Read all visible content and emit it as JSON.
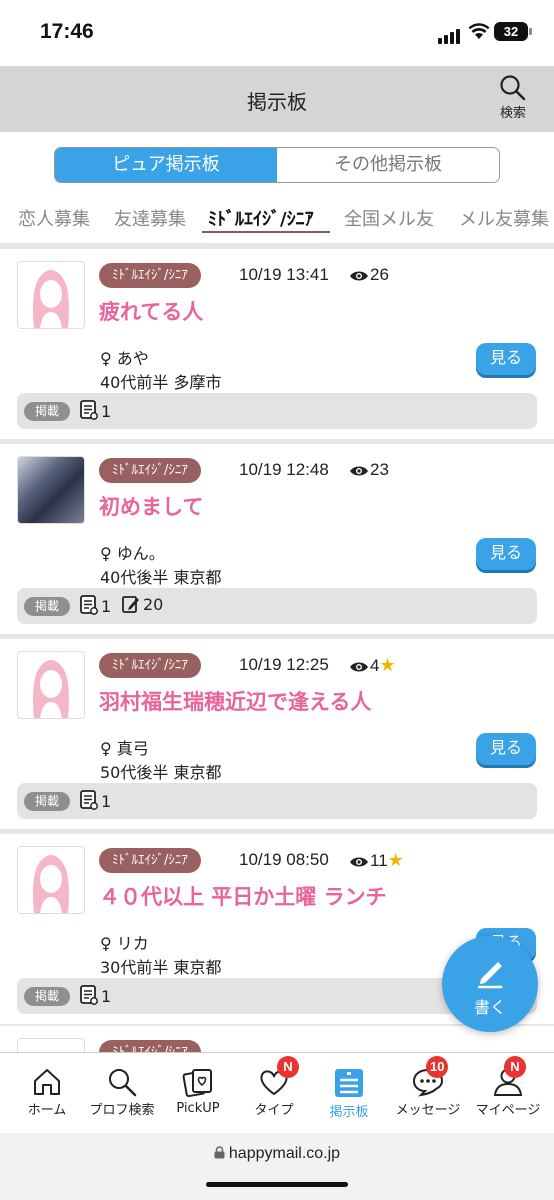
{
  "status": {
    "time": "17:46",
    "battery": "32"
  },
  "header": {
    "title": "掲示板",
    "search_label": "検索"
  },
  "board_tabs": [
    {
      "label": "ピュア掲示板",
      "active": true
    },
    {
      "label": "その他掲示板",
      "active": false
    }
  ],
  "categories": [
    "恋人募集",
    "友達募集",
    "ﾐﾄﾞﾙｴｲｼﾞ/ｼﾆｱ",
    "全国メル友",
    "メル友募集"
  ],
  "active_category": "ﾐﾄﾞﾙｴｲｼﾞ/ｼﾆｱ",
  "posts": [
    {
      "category": "ﾐﾄﾞﾙｴｲｼﾞ/ｼﾆｱ",
      "date": "10/19 13:41",
      "views": "26",
      "star": false,
      "title": "疲れてる人",
      "name": "♀ あや",
      "age_area": "40代前半 多摩市",
      "button": "見る",
      "posted": "掲載",
      "count1": "1",
      "count2": "",
      "avatar": "default"
    },
    {
      "category": "ﾐﾄﾞﾙｴｲｼﾞ/ｼﾆｱ",
      "date": "10/19 12:48",
      "views": "23",
      "star": false,
      "title": "初めまして",
      "name": "♀ ゆん。",
      "age_area": "40代後半 東京都",
      "button": "見る",
      "posted": "掲載",
      "count1": "1",
      "count2": "20",
      "avatar": "photo"
    },
    {
      "category": "ﾐﾄﾞﾙｴｲｼﾞ/ｼﾆｱ",
      "date": "10/19 12:25",
      "views": "4",
      "star": true,
      "title": "羽村福生瑞穂近辺で逢える人",
      "name": "♀ 真弓",
      "age_area": "50代後半 東京都",
      "button": "見る",
      "posted": "掲載",
      "count1": "1",
      "count2": "",
      "avatar": "default"
    },
    {
      "category": "ﾐﾄﾞﾙｴｲｼﾞ/ｼﾆｱ",
      "date": "10/19 08:50",
      "views": "11",
      "star": true,
      "title": "４０代以上 平日か土曜 ランチ",
      "name": "♀ リカ",
      "age_area": "30代前半 東京都",
      "button": "見る",
      "posted": "掲載",
      "count1": "1",
      "count2": "",
      "avatar": "default"
    }
  ],
  "fab_label": "書く",
  "nav": [
    {
      "label": "ホーム",
      "badge": ""
    },
    {
      "label": "プロフ検索",
      "badge": ""
    },
    {
      "label": "PickUP",
      "badge": ""
    },
    {
      "label": "タイプ",
      "badge": "N"
    },
    {
      "label": "掲示板",
      "badge": ""
    },
    {
      "label": "メッセージ",
      "badge": "10"
    },
    {
      "label": "マイページ",
      "badge": "N"
    }
  ],
  "active_nav": "掲示板",
  "url": "happymail.co.jp"
}
